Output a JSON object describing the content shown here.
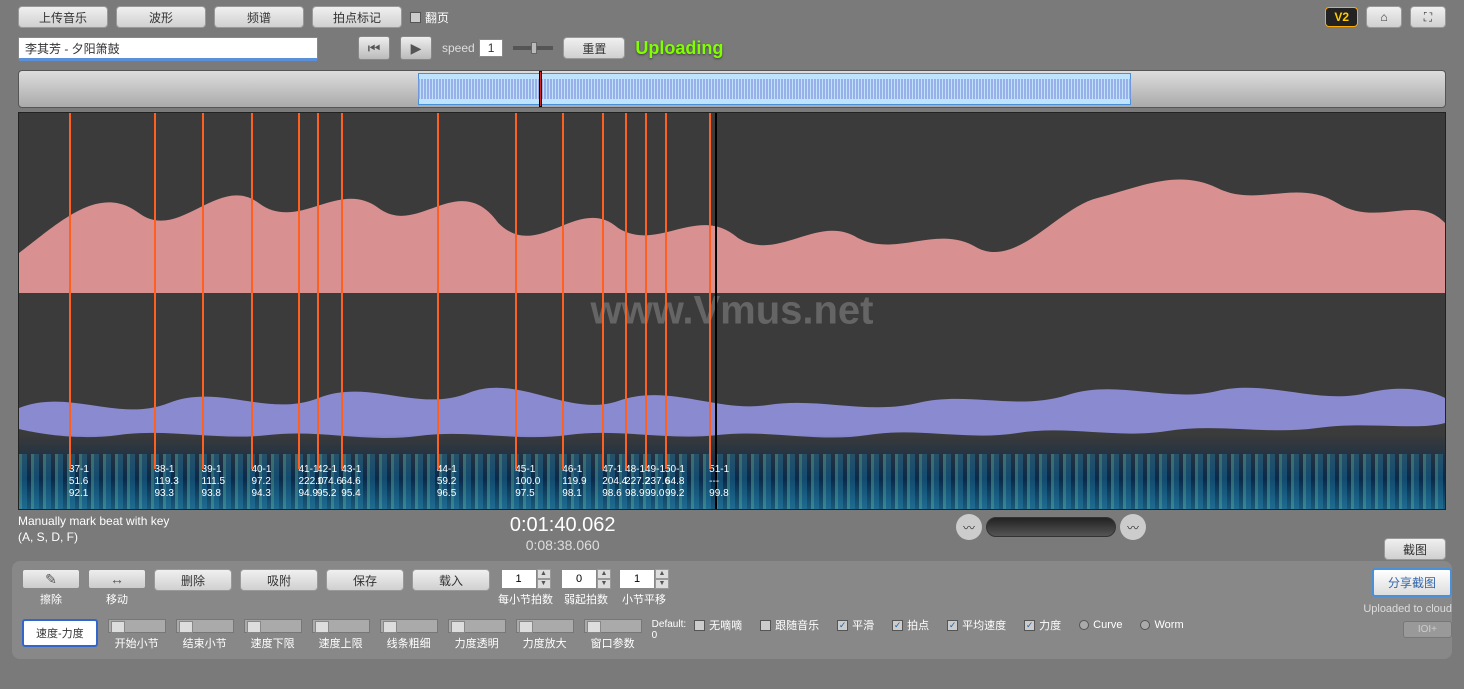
{
  "toolbar": {
    "upload": "上传音乐",
    "waveform": "波形",
    "spectrum": "频谱",
    "beatmark": "拍点标记",
    "flip_cb": "翻页",
    "version": "V2"
  },
  "track": {
    "title": "李其芳 - 夕阳箫鼓"
  },
  "transport": {
    "speed_label": "speed",
    "speed_value": "1",
    "reset": "重置",
    "uploading": "Uploading"
  },
  "watermark": "www.Vmus.net",
  "markers": [
    {
      "pos": 3.5,
      "id": "37-1",
      "v1": "51.6",
      "v2": "92.1"
    },
    {
      "pos": 9.5,
      "id": "38-1",
      "v1": "119.3",
      "v2": "93.3"
    },
    {
      "pos": 12.8,
      "id": "39-1",
      "v1": "111.5",
      "v2": "93.8"
    },
    {
      "pos": 16.3,
      "id": "40-1",
      "v1": "97.2",
      "v2": "94.3"
    },
    {
      "pos": 19.6,
      "id": "41-1",
      "v1": "222.0",
      "v2": "94.9"
    },
    {
      "pos": 20.9,
      "id": "42-1",
      "v1": "174.6",
      "v2": "95.2"
    },
    {
      "pos": 22.6,
      "id": "43-1",
      "v1": "64.6",
      "v2": "95.4"
    },
    {
      "pos": 29.3,
      "id": "44-1",
      "v1": "59.2",
      "v2": "96.5"
    },
    {
      "pos": 34.8,
      "id": "45-1",
      "v1": "100.0",
      "v2": "97.5"
    },
    {
      "pos": 38.1,
      "id": "46-1",
      "v1": "119.9",
      "v2": "98.1"
    },
    {
      "pos": 40.9,
      "id": "47-1",
      "v1": "204.4",
      "v2": "98.6"
    },
    {
      "pos": 42.5,
      "id": "48-1",
      "v1": "227.2",
      "v2": "98.9"
    },
    {
      "pos": 43.9,
      "id": "49-1",
      "v1": "237.6",
      "v2": "99.0"
    },
    {
      "pos": 45.3,
      "id": "50-1",
      "v1": "64.8",
      "v2": "99.2"
    },
    {
      "pos": 48.4,
      "id": "51-1",
      "v1": "---",
      "v2": "99.8"
    }
  ],
  "status": {
    "hint1": "Manually mark beat with key",
    "hint2": "(A, S, D, F)",
    "time_current": "0:01:40.062",
    "time_total": "0:08:38.060",
    "screenshot": "截图"
  },
  "tools": {
    "erase": "擦除",
    "move": "移动",
    "delete": "删除",
    "snap": "吸附",
    "save": "保存",
    "load": "载入",
    "beats_per_bar": "每小节拍数",
    "beats_per_bar_v": "1",
    "pickup": "弱起拍数",
    "pickup_v": "0",
    "bar_offset": "小节平移",
    "bar_offset_v": "1"
  },
  "panel2": {
    "speed_force": "速度-力度",
    "start_bar": "开始小节",
    "end_bar": "结束小节",
    "speed_lo": "速度下限",
    "speed_hi": "速度上限",
    "line_weight": "线条粗细",
    "dyn_trans": "力度透明",
    "dyn_zoom": "力度放大",
    "win_param": "窗口参数",
    "default_l": "Default:",
    "default_v": "0"
  },
  "checks": {
    "no_whistle": "无嘀嘀",
    "follow": "跟随音乐",
    "smooth": "平滑",
    "beat": "拍点",
    "avg_speed": "平均速度",
    "dynamics": "力度",
    "curve": "Curve",
    "worm": "Worm"
  },
  "right": {
    "share": "分享截图",
    "uploaded": "Uploaded to cloud",
    "ioi": "IOI+"
  }
}
